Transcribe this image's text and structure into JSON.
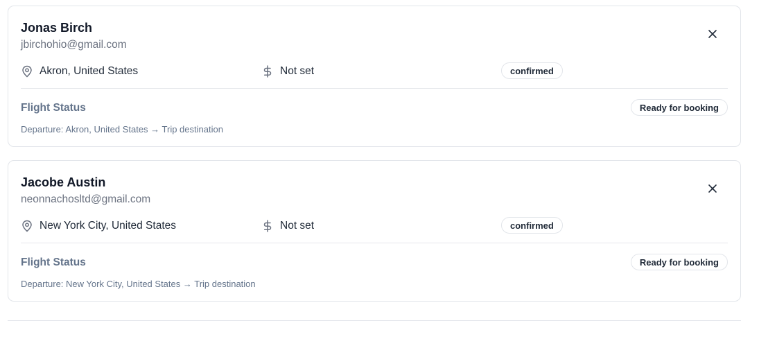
{
  "cards": [
    {
      "name": "Jonas Birch",
      "email": "jbirchohio@gmail.com",
      "location": "Akron, United States",
      "budget": "Not set",
      "status": "confirmed",
      "flight_status_label": "Flight Status",
      "flight_status_badge": "Ready for booking",
      "departure": "Departure: Akron, United States → Trip destination"
    },
    {
      "name": "Jacobe Austin",
      "email": "neonnachosltd@gmail.com",
      "location": "New York City, United States",
      "budget": "Not set",
      "status": "confirmed",
      "flight_status_label": "Flight Status",
      "flight_status_badge": "Ready for booking",
      "departure": "Departure: New York City, United States → Trip destination"
    }
  ],
  "icons": {
    "location": "map-pin-icon",
    "budget": "dollar-sign-icon",
    "close": "close-icon"
  },
  "colors": {
    "border": "#e2e5ea",
    "muted_text": "#64748b",
    "heading_text": "#111827"
  }
}
